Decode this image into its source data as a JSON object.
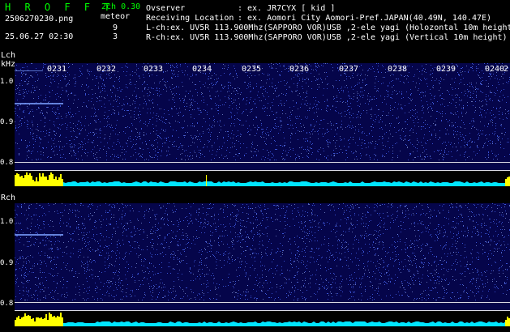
{
  "header": {
    "brand": "H R O F F T",
    "version": "2ch 0.30",
    "filename": "2506270230.png",
    "meteor_label": "meteor",
    "lch_count": "9",
    "rch_count": "3",
    "timestamp": "25.06.27 02:30",
    "observer_label": "Ovserver",
    "observer_sep": ":",
    "observer_value": "ex. JR7CYX [ kid ]",
    "location_label": "Receiving Location",
    "location_sep": ":",
    "location_value": "ex. Aomori City Aomori-Pref.JAPAN(40.49N, 140.47E)",
    "lch_info": "L-ch:ex. UV5R 113.900Mhz(SAPPORO VOR)USB ,2-ele yagi (Holozontal 10m height)",
    "rch_info": "R-ch:ex. UV5R 113.900Mhz(SAPPORO VOR)USB ,2-ele yagi (Vertical 10m height)"
  },
  "lch": {
    "name": "Lch",
    "unit": "kHz",
    "ticks": [
      "1.0",
      "0.9",
      "0.8"
    ]
  },
  "rch": {
    "name": "Rch",
    "ticks": [
      "1.0",
      "0.9",
      "0.8"
    ]
  },
  "time_labels": [
    "0231",
    "0232",
    "0233",
    "0234",
    "0235",
    "0236",
    "0237",
    "0238",
    "0239",
    "0240",
    "2"
  ],
  "colors": {
    "background": "#000000",
    "panel": "#05054a",
    "noise": "#4b6bff",
    "baseline": "#00e5ff",
    "meteor": "#ffff00",
    "brand": "#00ff00"
  }
}
